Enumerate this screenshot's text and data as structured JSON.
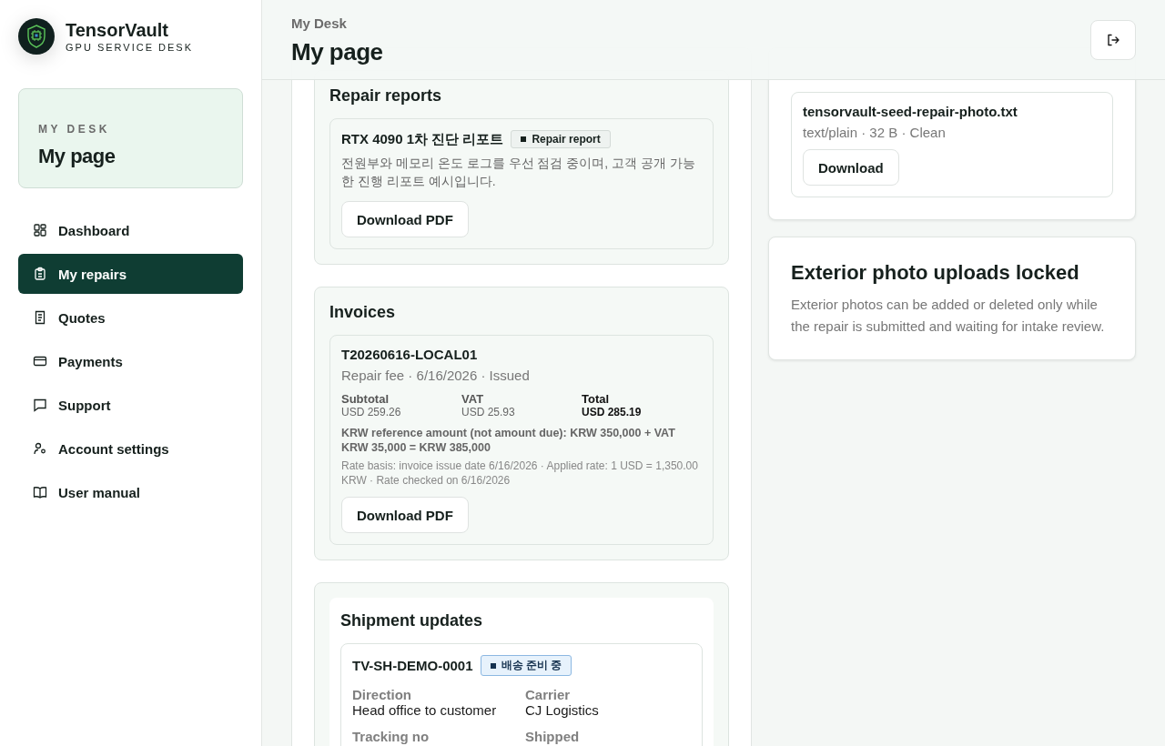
{
  "sidebar": {
    "brand": {
      "name": "TensorVault",
      "tagline": "GPU SERVICE DESK"
    },
    "desk_card": {
      "eyebrow": "MY DESK",
      "title": "My page"
    },
    "items": [
      {
        "label": "Dashboard",
        "kind": "grid",
        "selected": false
      },
      {
        "label": "My repairs",
        "kind": "clipboard",
        "selected": true
      },
      {
        "label": "Quotes",
        "kind": "receipt",
        "selected": false
      },
      {
        "label": "Payments",
        "kind": "card",
        "selected": false
      },
      {
        "label": "Support",
        "kind": "chat",
        "selected": false
      },
      {
        "label": "Account settings",
        "kind": "user",
        "selected": false
      },
      {
        "label": "User manual",
        "kind": "book",
        "selected": false
      }
    ]
  },
  "header": {
    "breadcrumb": "My Desk",
    "title": "My page"
  },
  "repair_reports": {
    "heading": "Repair reports",
    "items": [
      {
        "title": "RTX 4090 1차 진단 리포트",
        "badge": {
          "label": "Repair report",
          "kind": "neutral"
        },
        "description": "전원부와 메모리 온도 로그를 우선 점검 중이며, 고객 공개 가능한 진행 리포트 예시입니다.",
        "button": "Download PDF"
      }
    ]
  },
  "invoices": {
    "heading": "Invoices",
    "items": [
      {
        "number": "T20260616-LOCAL01",
        "meta": "Repair fee · 6/16/2026 · Issued",
        "amounts": [
          {
            "label": "Subtotal",
            "value": "USD 259.26",
            "emphasis": false
          },
          {
            "label": "VAT",
            "value": "USD 25.93",
            "emphasis": false
          },
          {
            "label": "Total",
            "value": "USD 285.19",
            "emphasis": true
          }
        ],
        "krw_note": "KRW reference amount (not amount due): KRW 350,000 + VAT KRW 35,000 = KRW 385,000",
        "rate_note": "Rate basis: invoice issue date 6/16/2026 · Applied rate: 1 USD = 1,350.00 KRW · Rate checked on 6/16/2026",
        "button": "Download PDF"
      }
    ]
  },
  "shipments": {
    "heading": "Shipment updates",
    "items": [
      {
        "id": "TV-SH-DEMO-0001",
        "badge": {
          "label": "배송 준비 중",
          "kind": "info"
        },
        "fields": [
          {
            "label": "Direction",
            "value": "Head office to customer"
          },
          {
            "label": "Carrier",
            "value": "CJ Logistics"
          },
          {
            "label": "Tracking no"
          },
          {
            "label": "Shipped"
          }
        ]
      }
    ]
  },
  "attachments": {
    "files": [
      {
        "name": "tensorvault-seed-repair-photo.txt",
        "meta": "text/plain · 32 B · Clean",
        "button": "Download"
      }
    ]
  },
  "upload_lock": {
    "title": "Exterior photo uploads locked",
    "text": "Exterior photos can be added or deleted only while the repair is submitted and waiting for intake review."
  }
}
